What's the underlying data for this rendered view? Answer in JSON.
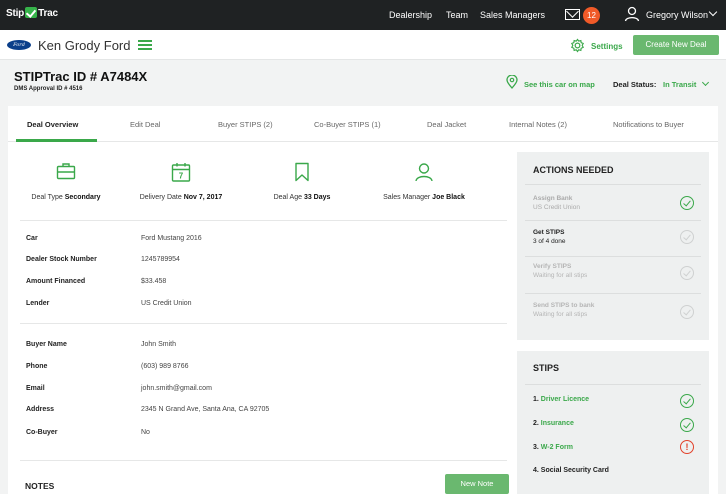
{
  "topnav": {
    "logo": {
      "left": "Stip",
      "right": "Trac"
    },
    "links": [
      "Dealership",
      "Team",
      "Sales Managers"
    ],
    "notification_count": "12",
    "user_name": "Gregory Wilson"
  },
  "dealer": {
    "logo_text": "Ford",
    "name": "Ken Grody Ford",
    "settings_label": "Settings",
    "create_label": "Create New Deal"
  },
  "deal": {
    "title": "STIPTrac ID # A7484X",
    "dms_id": "DMS Approval ID # 4516",
    "map_link": "See this car on map",
    "status_label": "Deal Status:",
    "status_value": "In Transit"
  },
  "tabs": [
    {
      "label": "Deal Overview"
    },
    {
      "label": "Edit Deal"
    },
    {
      "label": "Buyer STIPS (2)"
    },
    {
      "label": "Co-Buyer STIPS (1)"
    },
    {
      "label": "Deal Jacket"
    },
    {
      "label": "Internal Notes (2)"
    },
    {
      "label": "Notifications to Buyer"
    }
  ],
  "stats": [
    {
      "label": "Deal Type",
      "value": "Secondary",
      "icon": "briefcase-icon"
    },
    {
      "label": "Delivery Date",
      "value": "Nov 7, 2017",
      "icon": "calendar-icon",
      "calendar_day": "7"
    },
    {
      "label": "Deal Age",
      "value": "33 Days",
      "icon": "bookmark-icon"
    },
    {
      "label": "Sales Manager",
      "value": "Joe Black",
      "icon": "person-icon"
    }
  ],
  "vehicle": [
    {
      "label": "Car",
      "value": "Ford Mustang 2016"
    },
    {
      "label": "Dealer Stock Number",
      "value": "1245789954"
    },
    {
      "label": "Amount Financed",
      "value": "$33.458"
    },
    {
      "label": "Lender",
      "value": "US Credit Union"
    }
  ],
  "buyer": [
    {
      "label": "Buyer Name",
      "value": "John Smith"
    },
    {
      "label": "Phone",
      "value": "(603) 989 8766"
    },
    {
      "label": "Email",
      "value": "john.smith@gmail.com"
    },
    {
      "label": "Address",
      "value": "2345 N Grand Ave, Santa Ana, CA 92705"
    },
    {
      "label": "Co-Buyer",
      "value": "No"
    }
  ],
  "notes": {
    "title": "NOTES",
    "new_note_label": "New Note"
  },
  "actions_needed": {
    "title": "ACTIONS NEEDED",
    "items": [
      {
        "title": "Assign Bank",
        "sub": "US Credit Union",
        "state": "done"
      },
      {
        "title": "Get STIPS",
        "sub": "3 of 4 done",
        "state": "current"
      },
      {
        "title": "Verify STIPS",
        "sub": "Waiting for all stips",
        "state": "pending"
      },
      {
        "title": "Send STIPS to bank",
        "sub": "Waiting for all stips",
        "state": "pending"
      }
    ]
  },
  "stips": {
    "title": "STIPS",
    "items": [
      {
        "num": "1.",
        "name": "Driver Licence",
        "state": "ok"
      },
      {
        "num": "2.",
        "name": "Insurance",
        "state": "ok"
      },
      {
        "num": "3.",
        "name": "W-2 Form",
        "state": "alert"
      },
      {
        "num": "4.",
        "name": "Social Security Card",
        "state": "none"
      }
    ]
  },
  "colors": {
    "accent_green": "#3aa84a",
    "button_green": "#6ab86f",
    "alert_red": "#e2422b",
    "badge_orange": "#f05a28",
    "nav_dark": "#1f2223"
  }
}
